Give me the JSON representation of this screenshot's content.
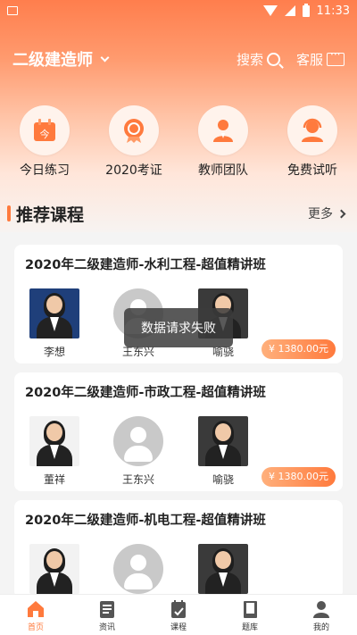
{
  "status_bar": {
    "time": "11:33"
  },
  "header": {
    "city": "二级建造师",
    "search_label": "搜索",
    "service_label": "客服"
  },
  "quick_menu": [
    {
      "label": "今日练习",
      "icon": "calendar-icon"
    },
    {
      "label": "2020考证",
      "icon": "medal-icon"
    },
    {
      "label": "教师团队",
      "icon": "teacher-icon"
    },
    {
      "label": "免费试听",
      "icon": "headset-icon"
    }
  ],
  "section": {
    "title": "推荐课程",
    "more": "更多"
  },
  "courses": [
    {
      "title": "2020年二级建造师-水利工程-超值精讲班",
      "teachers": [
        "李想",
        "王东兴",
        "喻骁"
      ],
      "price": "¥ 1380.00元"
    },
    {
      "title": "2020年二级建造师-市政工程-超值精讲班",
      "teachers": [
        "董祥",
        "王东兴",
        "喻骁"
      ],
      "price": "¥ 1380.00元"
    },
    {
      "title": "2020年二级建造师-机电工程-超值精讲班",
      "teachers": [
        "",
        "",
        ""
      ]
    }
  ],
  "toast": "数据请求失败",
  "bottom_nav": [
    {
      "label": "首页",
      "active": true
    },
    {
      "label": "资讯"
    },
    {
      "label": "课程"
    },
    {
      "label": "题库"
    },
    {
      "label": "我的"
    }
  ],
  "colors": {
    "accent": "#ff7a3d",
    "header_top": "#ff7e4d"
  }
}
